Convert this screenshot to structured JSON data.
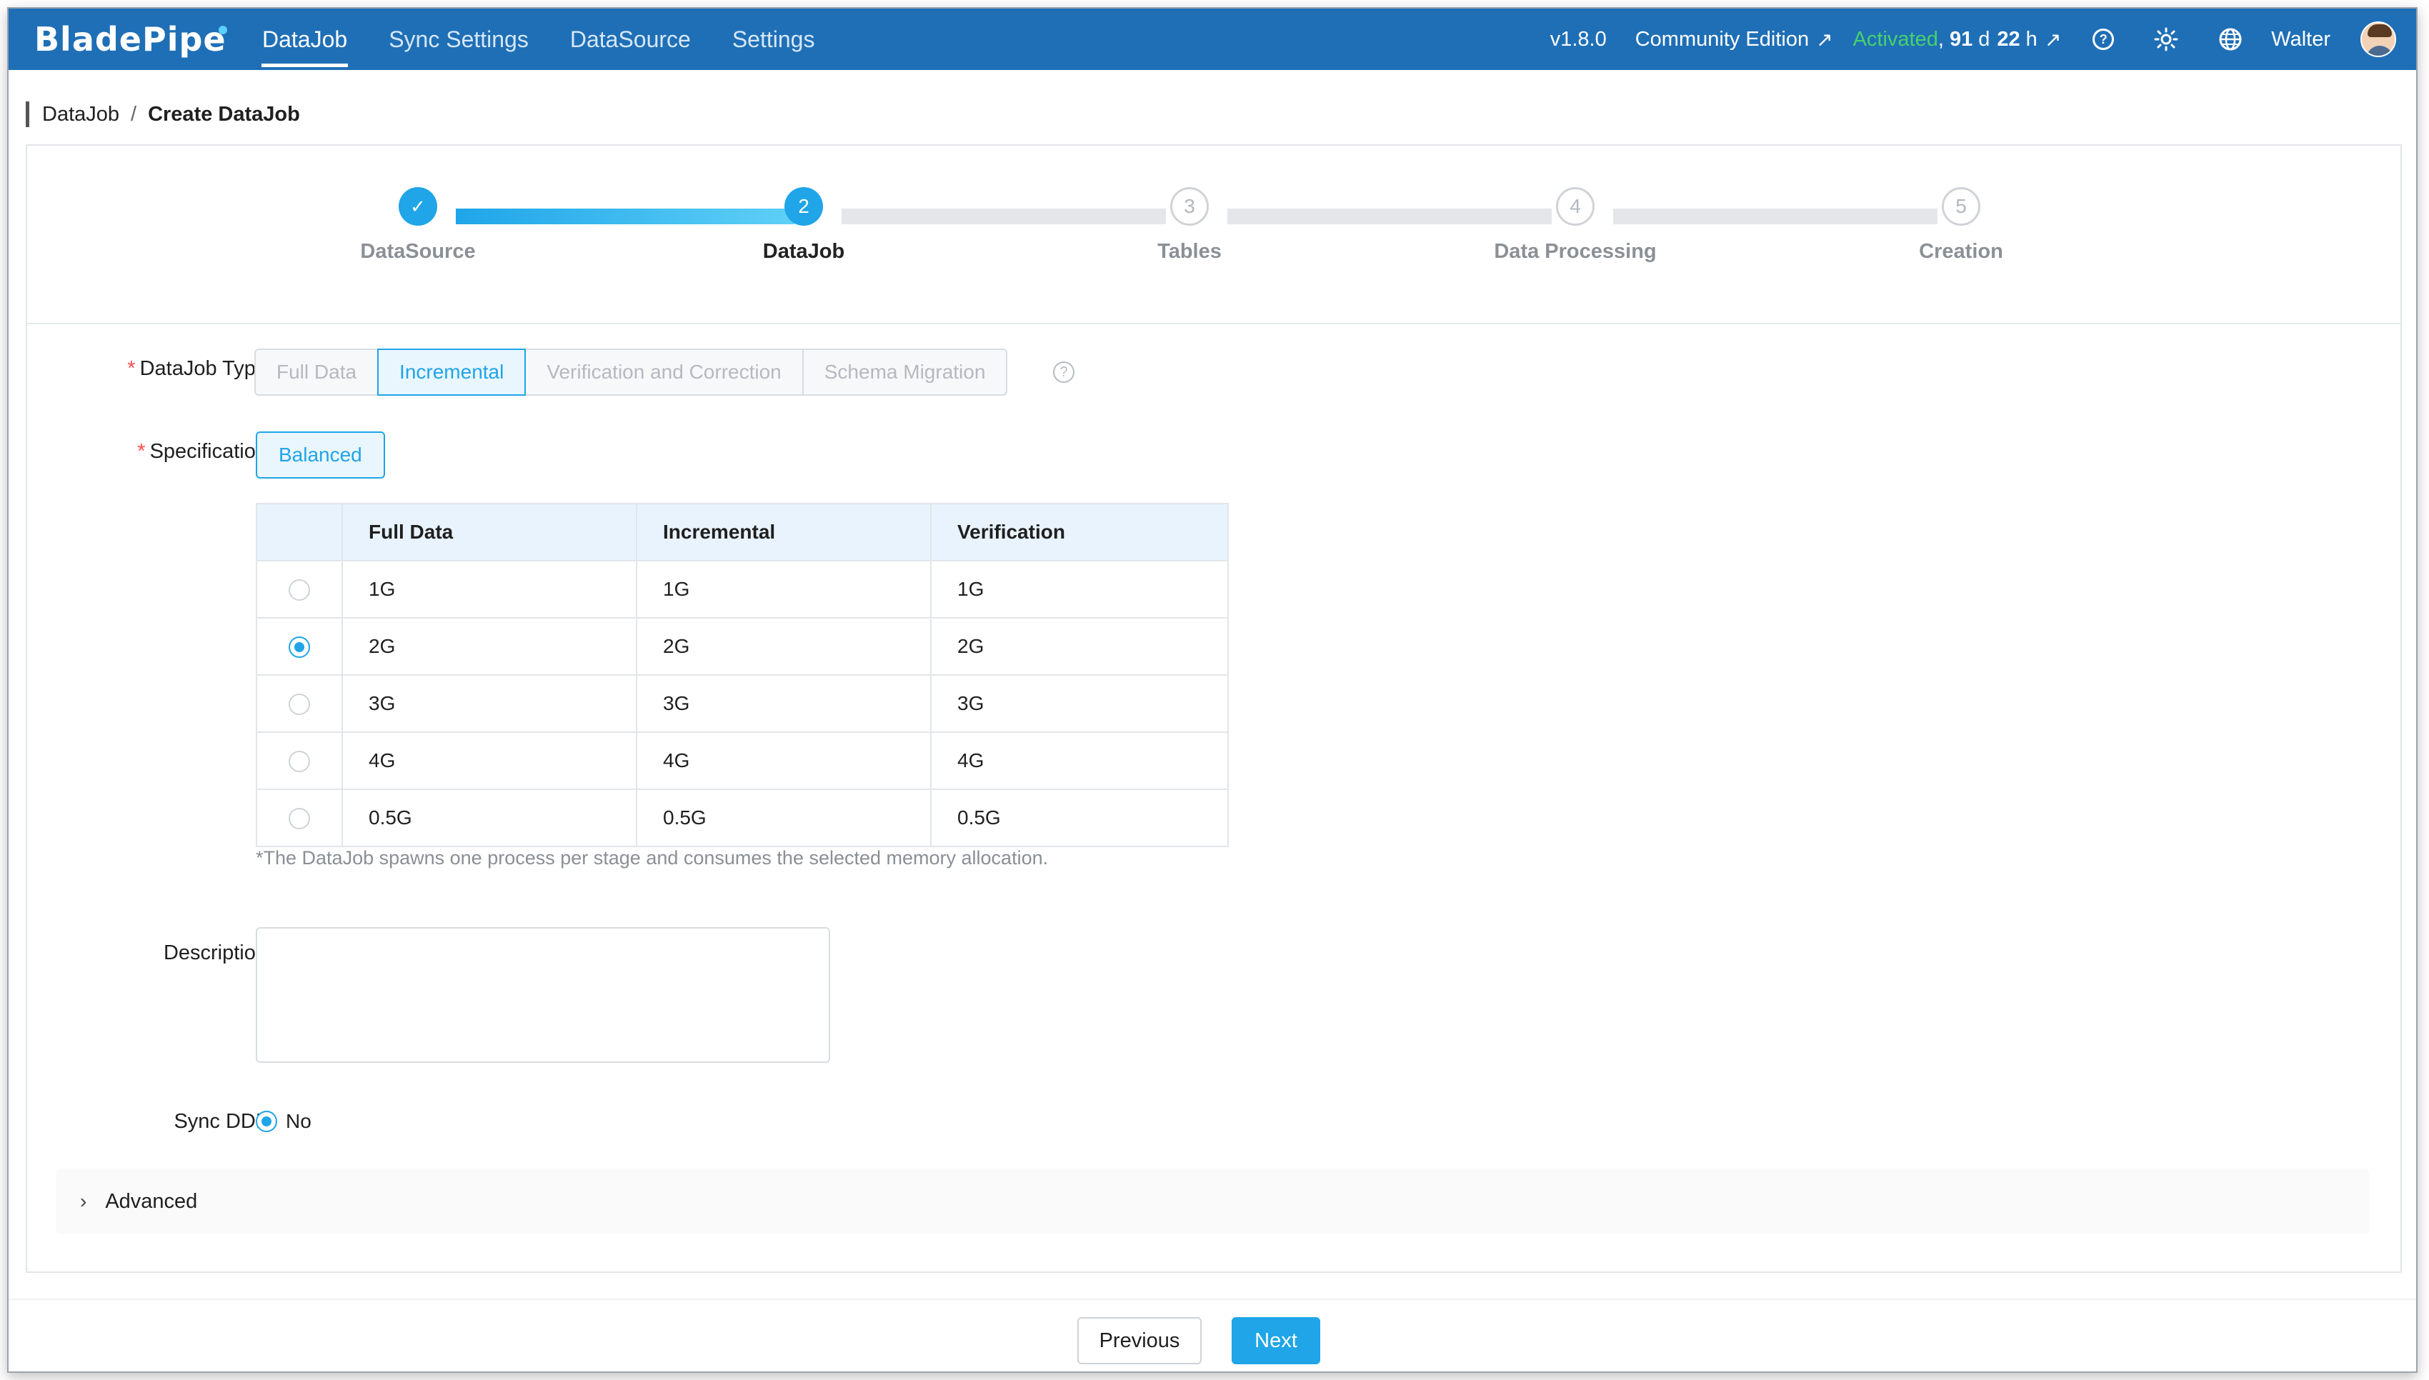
{
  "app": {
    "logo_text": "BladePipe",
    "nav": [
      "DataJob",
      "Sync Settings",
      "DataSource",
      "Settings"
    ],
    "version": "v1.8.0",
    "edition": "Community Edition",
    "activated": "Activated",
    "license_prefix": ", ",
    "license_days": "91",
    "license_days_unit": "d",
    "license_hours": "22",
    "license_hours_unit": "h",
    "user": "Walter"
  },
  "breadcrumb": {
    "parent": "DataJob",
    "separator": "/",
    "current": "Create DataJob"
  },
  "steps": [
    {
      "label": "DataSource",
      "num": "✓",
      "state": "done"
    },
    {
      "label": "DataJob",
      "num": "2",
      "state": "current"
    },
    {
      "label": "Tables",
      "num": "3",
      "state": "todo"
    },
    {
      "label": "Data Processing",
      "num": "4",
      "state": "todo"
    },
    {
      "label": "Creation",
      "num": "5",
      "state": "todo"
    }
  ],
  "form": {
    "datajob_type_label": "DataJob Type",
    "datajob_types": [
      "Full Data",
      "Incremental",
      "Verification and Correction",
      "Schema Migration"
    ],
    "datajob_type_selected": "Incremental",
    "help_glyph": "?",
    "specification_label": "Specification",
    "specification_value": "Balanced",
    "spec_table": {
      "headers": [
        "",
        "Full Data",
        "Incremental",
        "Verification"
      ],
      "rows": [
        {
          "selected": false,
          "full": "1G",
          "incremental": "1G",
          "verification": "1G"
        },
        {
          "selected": true,
          "full": "2G",
          "incremental": "2G",
          "verification": "2G"
        },
        {
          "selected": false,
          "full": "3G",
          "incremental": "3G",
          "verification": "3G"
        },
        {
          "selected": false,
          "full": "4G",
          "incremental": "4G",
          "verification": "4G"
        },
        {
          "selected": false,
          "full": "0.5G",
          "incremental": "0.5G",
          "verification": "0.5G"
        }
      ]
    },
    "spec_note": "*The DataJob spawns one process per stage and consumes the selected memory allocation.",
    "description_label": "Description",
    "description_value": "",
    "sync_ddl_label": "Sync DDL",
    "sync_ddl_option": "No",
    "advanced_label": "Advanced"
  },
  "footer": {
    "previous": "Previous",
    "next": "Next"
  },
  "colors": {
    "topbar": "#1f6fb6",
    "accent": "#1fa5e8",
    "activated": "#47d16c",
    "required": "#ff4d4f"
  }
}
